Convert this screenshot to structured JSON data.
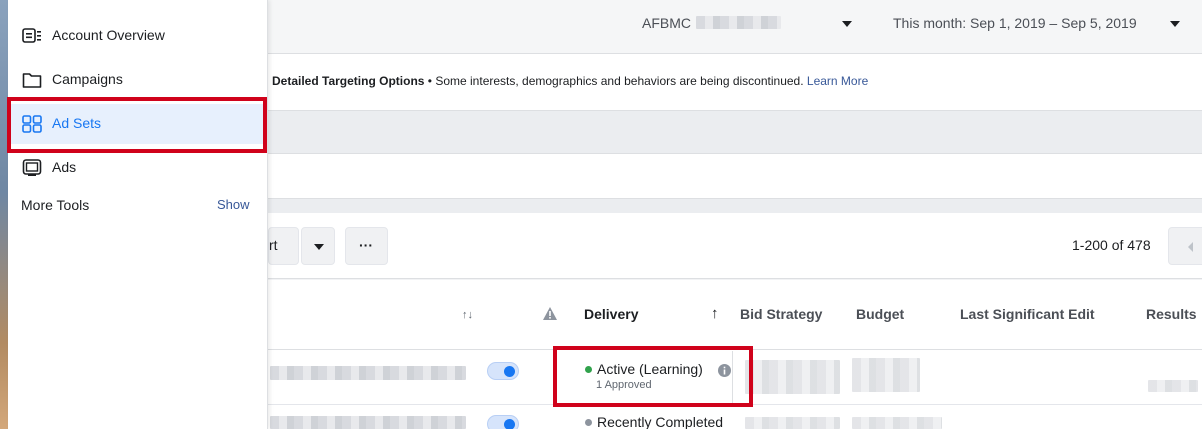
{
  "header": {
    "account_label": "AFBMC",
    "date_range": "This month: Sep 1, 2019 – Sep 5, 2019"
  },
  "notice": {
    "title": "Detailed Targeting Options",
    "message": " • Some interests, demographics and behaviors are being discontinued. ",
    "link": "Learn More"
  },
  "sidebar": {
    "items": [
      {
        "label": "Account Overview",
        "icon": "account-overview-icon"
      },
      {
        "label": "Campaigns",
        "icon": "folder-icon"
      },
      {
        "label": "Ad Sets",
        "icon": "grid-icon"
      },
      {
        "label": "Ads",
        "icon": "ad-icon"
      }
    ],
    "more_tools_label": "More Tools",
    "show_label": "Show"
  },
  "toolbar": {
    "export_fragment": "rt",
    "more_label": "···",
    "pagination": "1-200 of 478"
  },
  "table": {
    "columns": [
      "Delivery",
      "Bid Strategy",
      "Budget",
      "Last Significant Edit",
      "Results"
    ],
    "sort_icon": "↑↓",
    "sort_arrow": "↑",
    "rows": [
      {
        "delivery": "Active (Learning)",
        "sub": "1 Approved",
        "status_color": "#31a24c",
        "toggle_on": true
      },
      {
        "delivery": "Recently Completed",
        "sub": "",
        "status_color": "#8d949e",
        "toggle_on": true
      }
    ]
  },
  "colors": {
    "accent": "#1877f2",
    "highlight": "#d0021b"
  }
}
